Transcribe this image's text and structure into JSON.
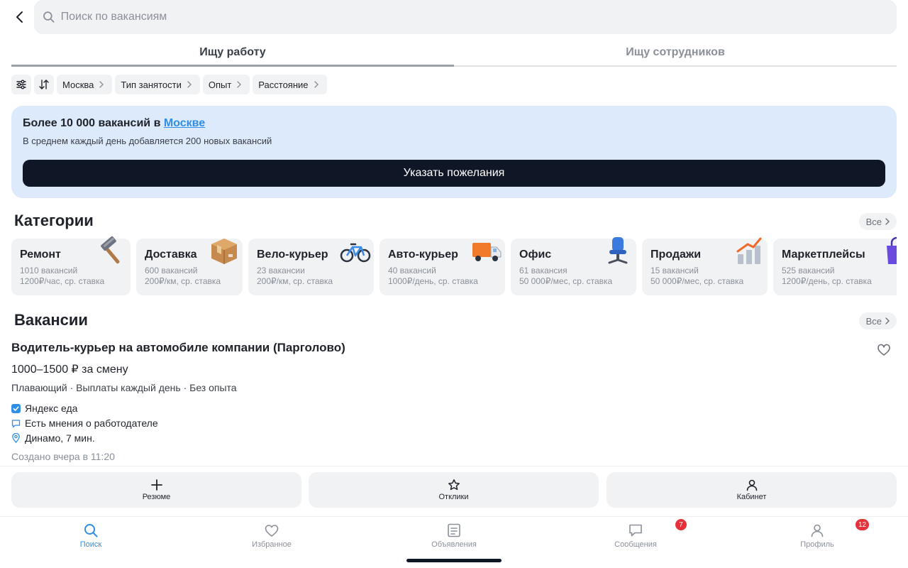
{
  "search": {
    "placeholder": "Поиск по вакансиям"
  },
  "tabs": [
    {
      "label": "Ищу работу",
      "active": true
    },
    {
      "label": "Ищу сотрудников",
      "active": false
    }
  ],
  "filters": [
    "Москва",
    "Тип занятости",
    "Опыт",
    "Расстояние"
  ],
  "banner": {
    "title_prefix": "Более 10 000 вакансий в ",
    "title_city": "Москве",
    "subtitle": "В среднем каждый день добавляется 200 новых вакансий",
    "button": "Указать пожелания"
  },
  "categories": {
    "title": "Категории",
    "all_label": "Все",
    "items": [
      {
        "name": "Ремонт",
        "count": "1010 вакансий",
        "rate": "1200₽/час, ср. ставка",
        "icon": "hammer-icon"
      },
      {
        "name": "Доставка",
        "count": "600 вакансий",
        "rate": "200₽/км, ср. ставка",
        "icon": "box-icon"
      },
      {
        "name": "Вело-курьер",
        "count": "23 вакансии",
        "rate": "200₽/км, ср. ставка",
        "icon": "bicycle-icon"
      },
      {
        "name": "Авто-курьер",
        "count": "40 вакансий",
        "rate": "1000₽/день, ср. ставка",
        "icon": "truck-icon"
      },
      {
        "name": "Офис",
        "count": "61 вакансия",
        "rate": "50 000₽/мес, ср. ставка",
        "icon": "office-chair-icon"
      },
      {
        "name": "Продажи",
        "count": "15 вакансий",
        "rate": "50 000₽/мес, ср. ставка",
        "icon": "chart-up-icon"
      },
      {
        "name": "Маркетплейсы",
        "count": "525 вакансий",
        "rate": "1200₽/день, ср. ставка",
        "icon": "shopping-bag-icon"
      }
    ]
  },
  "vacancies": {
    "title": "Вакансии",
    "all_label": "Все",
    "item": {
      "title": "Водитель-курьер на автомобиле компании (Парголово)",
      "salary": "1000–1500 ₽ за смену",
      "meta": "Плавающий · Выплаты каждый день · Без опыта",
      "company": "Яндекс еда",
      "reviews": "Есть мнения о работодателе",
      "location": "Динамо, 7 мин.",
      "created": "Создано вчера в 11:20"
    }
  },
  "actions": [
    {
      "label": "Резюме",
      "icon": "plus-icon"
    },
    {
      "label": "Отклики",
      "icon": "star-icon"
    },
    {
      "label": "Кабинет",
      "icon": "person-icon"
    }
  ],
  "nav": [
    {
      "label": "Поиск",
      "icon": "search-icon",
      "active": true,
      "badge": ""
    },
    {
      "label": "Избранное",
      "icon": "heart-icon",
      "active": false,
      "badge": ""
    },
    {
      "label": "Объявления",
      "icon": "document-icon",
      "active": false,
      "badge": ""
    },
    {
      "label": "Сообщения",
      "icon": "chat-icon",
      "active": false,
      "badge": "7"
    },
    {
      "label": "Профиль",
      "icon": "person-icon",
      "active": false,
      "badge": "12"
    }
  ],
  "colors": {
    "accent": "#2f8ee5",
    "banner_bg": "#dceafb",
    "button_dark": "#0f1626",
    "badge": "#e5323a"
  }
}
